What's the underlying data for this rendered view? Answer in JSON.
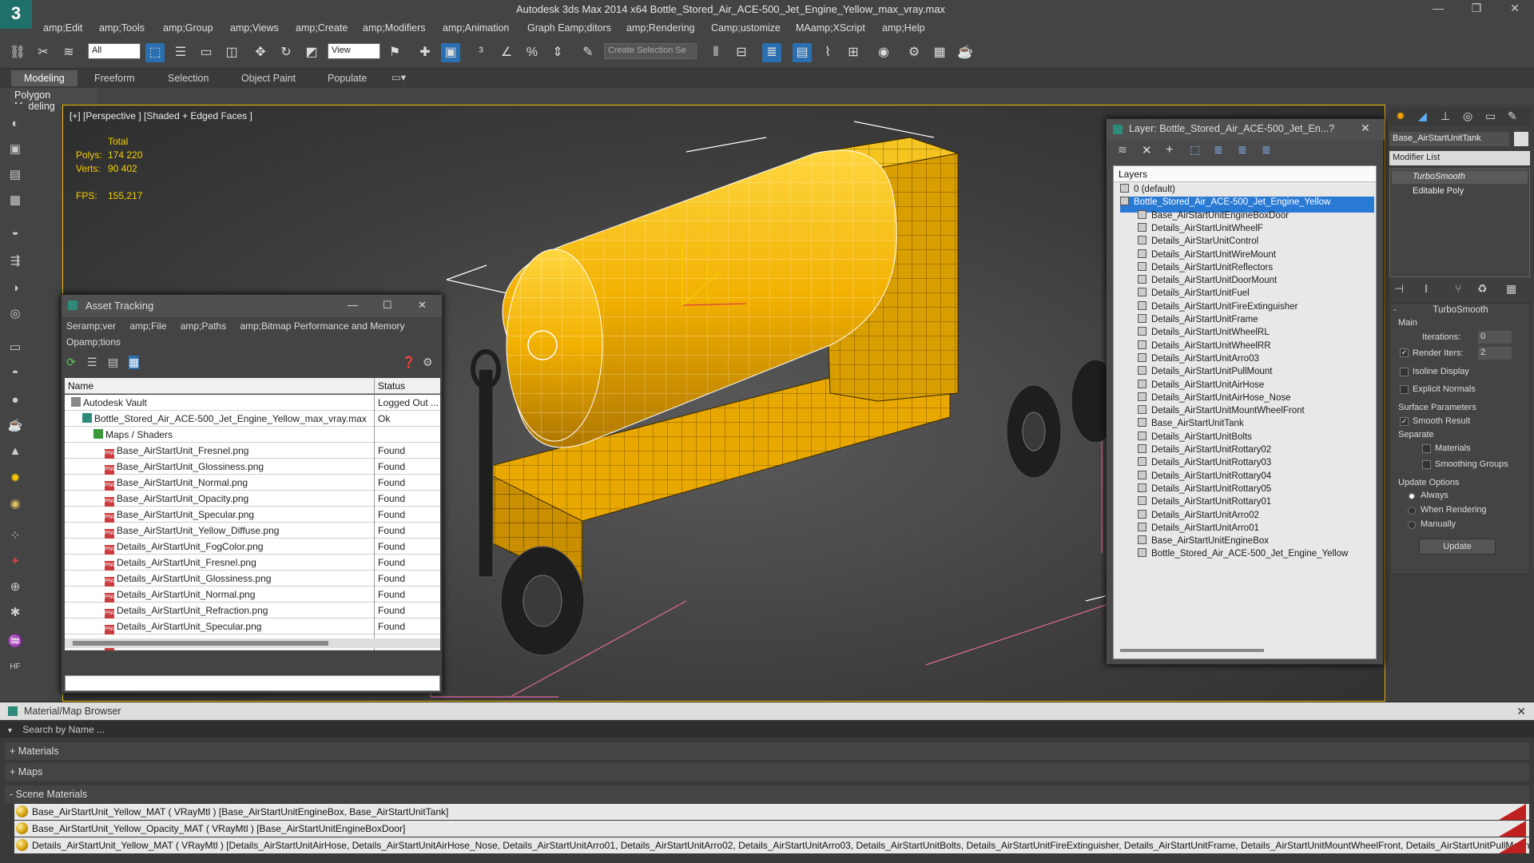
{
  "app": {
    "title": "Autodesk 3ds Max  2014 x64      Bottle_Stored_Air_ACE-500_Jet_Engine_Yellow_max_vray.max",
    "logo_letter": "3"
  },
  "menus": [
    "amp;Edit",
    "amp;Tools",
    "amp;Group",
    "amp;Views",
    "amp;Create",
    "amp;Modifiers",
    "amp;Animation",
    "Graph Eamp;ditors",
    "amp;Rendering",
    "Camp;ustomize",
    "MAamp;XScript",
    "amp;Help"
  ],
  "toolbar": {
    "selection_filter": "All",
    "ref_coord": "View",
    "named_selection_placeholder": "Create Selection Se"
  },
  "ribbon": {
    "tabs": [
      "Modeling",
      "Freeform",
      "Selection",
      "Object Paint",
      "Populate"
    ],
    "active_tab": "Modeling",
    "sub_label": "Polygon Modeling"
  },
  "viewport": {
    "label": "[+] [Perspective ] [Shaded + Edged Faces ]",
    "stats": {
      "total_label": "Total",
      "polys_label": "Polys:",
      "polys_value": "174 220",
      "verts_label": "Verts:",
      "verts_value": "90 402",
      "fps_label": "FPS:",
      "fps_value": "155,217"
    },
    "colors": {
      "frame": "#f0c000",
      "tank": "#f2b400"
    }
  },
  "asset_tracking": {
    "title": "Asset Tracking",
    "menus": [
      "Seramp;ver",
      "amp;File",
      "amp;Paths",
      "amp;Bitmap Performance and Memory",
      "Opamp;tions"
    ],
    "columns": [
      "Name",
      "Status"
    ],
    "rows": [
      {
        "name": "Autodesk Vault",
        "status": "Logged Out ...",
        "indent": 0,
        "kind": "vault"
      },
      {
        "name": "Bottle_Stored_Air_ACE-500_Jet_Engine_Yellow_max_vray.max",
        "status": "Ok",
        "indent": 1,
        "kind": "max"
      },
      {
        "name": "Maps / Shaders",
        "status": "",
        "indent": 2,
        "kind": "folder"
      },
      {
        "name": "Base_AirStartUnit_Fresnel.png",
        "status": "Found",
        "indent": 3,
        "kind": "png"
      },
      {
        "name": "Base_AirStartUnit_Glossiness.png",
        "status": "Found",
        "indent": 3,
        "kind": "png"
      },
      {
        "name": "Base_AirStartUnit_Normal.png",
        "status": "Found",
        "indent": 3,
        "kind": "png"
      },
      {
        "name": "Base_AirStartUnit_Opacity.png",
        "status": "Found",
        "indent": 3,
        "kind": "png"
      },
      {
        "name": "Base_AirStartUnit_Specular.png",
        "status": "Found",
        "indent": 3,
        "kind": "png"
      },
      {
        "name": "Base_AirStartUnit_Yellow_Diffuse.png",
        "status": "Found",
        "indent": 3,
        "kind": "png"
      },
      {
        "name": "Details_AirStartUnit_FogColor.png",
        "status": "Found",
        "indent": 3,
        "kind": "png"
      },
      {
        "name": "Details_AirStartUnit_Fresnel.png",
        "status": "Found",
        "indent": 3,
        "kind": "png"
      },
      {
        "name": "Details_AirStartUnit_Glossiness.png",
        "status": "Found",
        "indent": 3,
        "kind": "png"
      },
      {
        "name": "Details_AirStartUnit_Normal.png",
        "status": "Found",
        "indent": 3,
        "kind": "png"
      },
      {
        "name": "Details_AirStartUnit_Refraction.png",
        "status": "Found",
        "indent": 3,
        "kind": "png"
      },
      {
        "name": "Details_AirStartUnit_Specular.png",
        "status": "Found",
        "indent": 3,
        "kind": "png"
      },
      {
        "name": "Details_AirStartUnit_Yellow_Diffuse.png",
        "status": "Found",
        "indent": 3,
        "kind": "png"
      }
    ],
    "png_badge": "PNG"
  },
  "layer_window": {
    "title": "Layer: Bottle_Stored_Air_ACE-500_Jet_En...",
    "help": "?",
    "header": "Layers",
    "items": [
      {
        "name": "0 (default)",
        "indent": 0,
        "selected": false
      },
      {
        "name": "Bottle_Stored_Air_ACE-500_Jet_Engine_Yellow",
        "indent": 0,
        "selected": true
      },
      {
        "name": "Base_AirStartUnitEngineBoxDoor",
        "indent": 1
      },
      {
        "name": "Details_AirStartUnitWheelF",
        "indent": 1
      },
      {
        "name": "Details_AirStarUnitControl",
        "indent": 1
      },
      {
        "name": "Details_AirStartUnitWireMount",
        "indent": 1
      },
      {
        "name": "Details_AirStartUnitReflectors",
        "indent": 1
      },
      {
        "name": "Details_AirStartUnitDoorMount",
        "indent": 1
      },
      {
        "name": "Details_AirStartUnitFuel",
        "indent": 1
      },
      {
        "name": "Details_AirStartUnitFireExtinguisher",
        "indent": 1
      },
      {
        "name": "Details_AirStartUnitFrame",
        "indent": 1
      },
      {
        "name": "Details_AirStartUnitWheelRL",
        "indent": 1
      },
      {
        "name": "Details_AirStartUnitWheelRR",
        "indent": 1
      },
      {
        "name": "Details_AirStartUnitArro03",
        "indent": 1
      },
      {
        "name": "Details_AirStartUnitPullMount",
        "indent": 1
      },
      {
        "name": "Details_AirStartUnitAirHose",
        "indent": 1
      },
      {
        "name": "Details_AirStartUnitAirHose_Nose",
        "indent": 1
      },
      {
        "name": "Details_AirStartUnitMountWheelFront",
        "indent": 1
      },
      {
        "name": "Base_AirStartUnitTank",
        "indent": 1
      },
      {
        "name": "Details_AirStartUnitBolts",
        "indent": 1
      },
      {
        "name": "Details_AirStartUnitRottary02",
        "indent": 1
      },
      {
        "name": "Details_AirStartUnitRottary03",
        "indent": 1
      },
      {
        "name": "Details_AirStartUnitRottary04",
        "indent": 1
      },
      {
        "name": "Details_AirStartUnitRottary05",
        "indent": 1
      },
      {
        "name": "Details_AirStartUnitRottary01",
        "indent": 1
      },
      {
        "name": "Details_AirStartUnitArro02",
        "indent": 1
      },
      {
        "name": "Details_AirStartUnitArro01",
        "indent": 1
      },
      {
        "name": "Base_AirStartUnitEngineBox",
        "indent": 1
      },
      {
        "name": "Bottle_Stored_Air_ACE-500_Jet_Engine_Yellow",
        "indent": 1
      }
    ]
  },
  "command_panel": {
    "object_name": "Base_AirStartUnitTank",
    "modifier_list": "Modifier List",
    "stack": [
      "TurboSmooth",
      "Editable Poly"
    ],
    "rollout_title": "TurboSmooth",
    "main_label": "Main",
    "iterations_label": "Iterations:",
    "iterations_value": "0",
    "render_iters_label": "Render Iters:",
    "render_iters_value": "2",
    "isoline_label": "Isoline Display",
    "explicit_normals_label": "Explicit Normals",
    "surface_params_label": "Surface Parameters",
    "smooth_result_label": "Smooth Result",
    "separate_label": "Separate",
    "materials_label": "Materials",
    "smoothing_groups_label": "Smoothing Groups",
    "update_options_label": "Update Options",
    "always_label": "Always",
    "when_rendering_label": "When Rendering",
    "manually_label": "Manually",
    "update_button": "Update",
    "minus": "-"
  },
  "material_browser": {
    "title": "Material/Map Browser",
    "search_placeholder": "Search by Name ...",
    "sections": [
      "+ Materials",
      "+ Maps",
      "- Scene Materials"
    ],
    "scene_materials": [
      "Base_AirStartUnit_Yellow_MAT ( VRayMtl ) [Base_AirStartUnitEngineBox, Base_AirStartUnitTank]",
      "Base_AirStartUnit_Yellow_Opacity_MAT ( VRayMtl ) [Base_AirStartUnitEngineBoxDoor]",
      "Details_AirStartUnit_Yellow_MAT ( VRayMtl ) [Details_AirStartUnitAirHose, Details_AirStartUnitAirHose_Nose, Details_AirStartUnitArro01, Details_AirStartUnitArro02, Details_AirStartUnitArro03, Details_AirStartUnitBolts, Details_AirStartUnitFireExtinguisher, Details_AirStartUnitFrame, Details_AirStartUnitMountWheelFront, Details_AirStartUnitPullMount, Details_AirStartU..."
    ]
  }
}
